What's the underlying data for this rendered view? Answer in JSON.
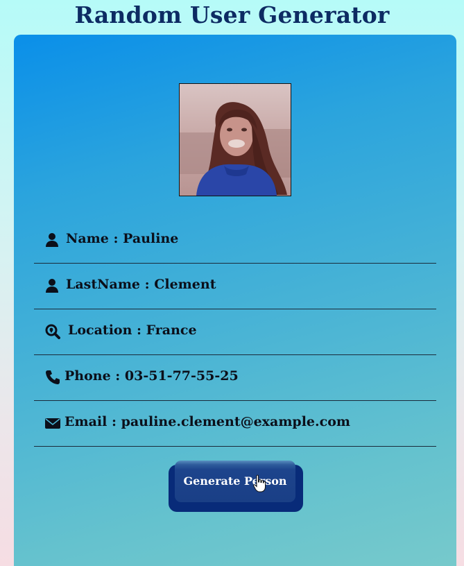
{
  "header": {
    "title": "Random User Generator"
  },
  "user": {
    "photo_icon": "user-photo",
    "rows": [
      {
        "icon": "user-icon",
        "text": "Name : Pauline"
      },
      {
        "icon": "user-icon",
        "text": "LastName : Clement"
      },
      {
        "icon": "search-location-icon",
        "text": "Location : France"
      },
      {
        "icon": "phone-icon",
        "text": "Phone : 03-51-77-55-25"
      },
      {
        "icon": "envelope-icon",
        "text": "Email : pauline.clement@example.com"
      }
    ]
  },
  "actions": {
    "generate_label": "Generate Person"
  },
  "colors": {
    "title": "#0d2b63",
    "card_top": "#0a8fe9",
    "card_bottom": "#78cacb",
    "button": "#1a3f86",
    "button_base": "#082b79"
  }
}
